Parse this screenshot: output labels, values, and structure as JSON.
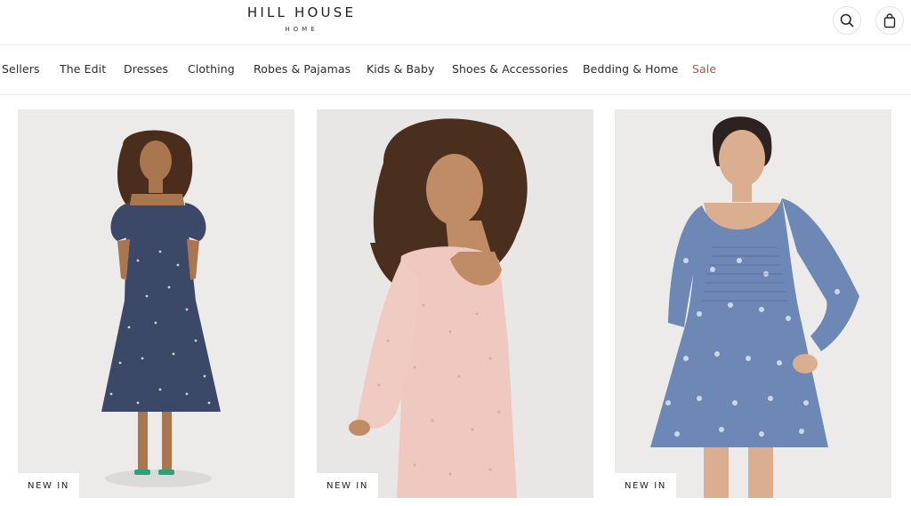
{
  "brand": {
    "name": "HILL HOUSE",
    "sub": "HOME"
  },
  "header": {
    "search_icon": "search-icon",
    "bag_icon": "shopping-bag-icon"
  },
  "nav": {
    "items": [
      {
        "label": "Sellers"
      },
      {
        "label": "The Edit"
      },
      {
        "label": "Dresses"
      },
      {
        "label": "Clothing"
      },
      {
        "label": "Robes & Pajamas"
      },
      {
        "label": "Kids & Baby"
      },
      {
        "label": "Shoes & Accessories"
      },
      {
        "label": "Bedding & Home"
      },
      {
        "label": "Sale"
      }
    ],
    "sale_color": "#b5513d"
  },
  "products": [
    {
      "badge": "NEW IN",
      "image": "model in navy printed square-neck midi dress"
    },
    {
      "badge": "NEW IN",
      "image": "model in pink floral long-sleeve dress"
    },
    {
      "badge": "NEW IN",
      "image": "model in blue floral smocked long-sleeve mini dress"
    }
  ]
}
